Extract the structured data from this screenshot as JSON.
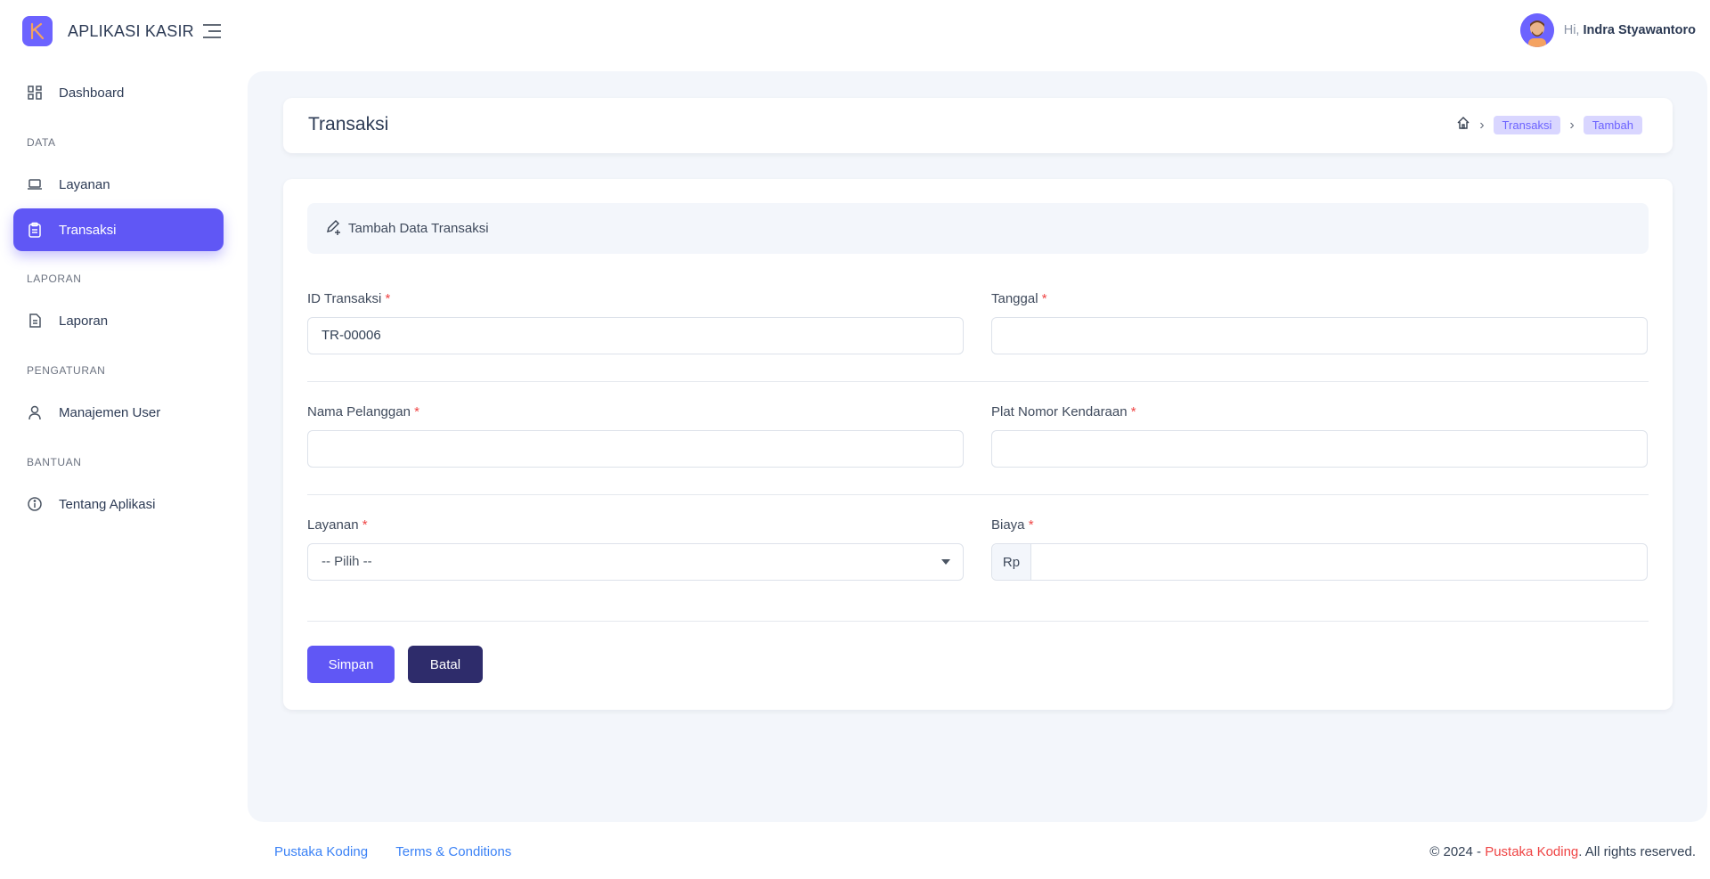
{
  "app": {
    "title": "APLIKASI KASIR",
    "accent": "#6057f5"
  },
  "user": {
    "greeting": "Hi,",
    "name": "Indra Styawantoro"
  },
  "sidebar": {
    "sections": [
      {
        "header": "",
        "items": [
          {
            "label": "Dashboard",
            "icon": "grid-icon"
          }
        ]
      },
      {
        "header": "DATA",
        "items": [
          {
            "label": "Layanan",
            "icon": "laptop-icon"
          },
          {
            "label": "Transaksi",
            "icon": "clipboard-icon",
            "active": true
          }
        ]
      },
      {
        "header": "LAPORAN",
        "items": [
          {
            "label": "Laporan",
            "icon": "document-icon"
          }
        ]
      },
      {
        "header": "PENGATURAN",
        "items": [
          {
            "label": "Manajemen User",
            "icon": "user-icon"
          }
        ]
      },
      {
        "header": "BANTUAN",
        "items": [
          {
            "label": "Tentang Aplikasi",
            "icon": "info-icon"
          }
        ]
      }
    ],
    "dashboard": "Dashboard",
    "data_header": "DATA",
    "layanan": "Layanan",
    "transaksi": "Transaksi",
    "laporan_header": "LAPORAN",
    "laporan": "Laporan",
    "pengaturan_header": "PENGATURAN",
    "manajemen_user": "Manajemen User",
    "bantuan_header": "BANTUAN",
    "tentang": "Tentang Aplikasi"
  },
  "page": {
    "title": "Transaksi",
    "breadcrumb": [
      "Transaksi",
      "Tambah"
    ]
  },
  "form": {
    "header": "Tambah Data Transaksi",
    "required_mark": "*",
    "id_label": "ID Transaksi",
    "id_value": "TR-00006",
    "tanggal_label": "Tanggal",
    "tanggal_value": "",
    "nama_label": "Nama Pelanggan",
    "nama_value": "",
    "plat_label": "Plat Nomor Kendaraan",
    "plat_value": "",
    "layanan_label": "Layanan",
    "layanan_selected": "-- Pilih --",
    "biaya_label": "Biaya",
    "biaya_prefix": "Rp",
    "biaya_value": "",
    "save_label": "Simpan",
    "cancel_label": "Batal"
  },
  "footer": {
    "links": [
      "Pustaka Koding",
      "Terms & Conditions"
    ],
    "copyright_prefix": "© 2024 - ",
    "copyright_brand": "Pustaka Koding",
    "copyright_suffix": ". All rights reserved."
  }
}
